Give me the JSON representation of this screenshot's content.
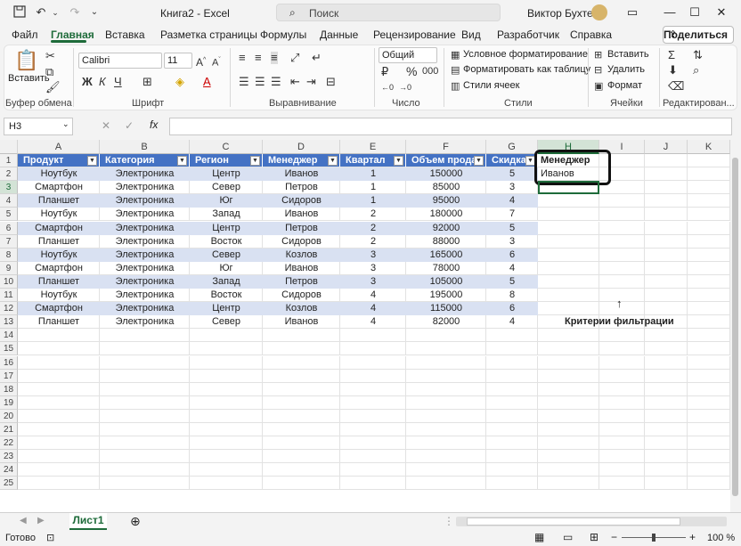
{
  "window": {
    "title": "Книга2  -  Excel",
    "search_placeholder": "Поиск",
    "user": "Виктор Бухтеев"
  },
  "tabs": [
    "Файл",
    "Главная",
    "Вставка",
    "Разметка страницы",
    "Формулы",
    "Данные",
    "Рецензирование",
    "Вид",
    "Разработчик",
    "Справка"
  ],
  "share_label": "Поделиться",
  "ribbon": {
    "clipboard": {
      "paste_label": "Вставить",
      "group": "Буфер обмена"
    },
    "font": {
      "name": "Calibri",
      "size": "11",
      "group": "Шрифт"
    },
    "alignment": {
      "group": "Выравнивание"
    },
    "number": {
      "format": "Общий",
      "group": "Число"
    },
    "styles": {
      "cond_format": "Условное форматирование",
      "format_table": "Форматировать как таблицу",
      "cell_styles": "Стили ячеек",
      "group": "Стили"
    },
    "cells": {
      "insert": "Вставить",
      "delete": "Удалить",
      "format": "Формат",
      "group": "Ячейки"
    },
    "editing": {
      "group": "Редактирован..."
    }
  },
  "formula_bar": {
    "name_box": "H3",
    "formula": ""
  },
  "columns": [
    "A",
    "B",
    "C",
    "D",
    "E",
    "F",
    "G",
    "H",
    "I",
    "J",
    "K"
  ],
  "rows": [
    "1",
    "2",
    "3",
    "4",
    "5",
    "6",
    "7",
    "8",
    "9",
    "10",
    "11",
    "12",
    "13",
    "14",
    "15",
    "16",
    "17",
    "18",
    "19",
    "20",
    "21",
    "22",
    "23",
    "24",
    "25"
  ],
  "table": {
    "headers": [
      "Продукт",
      "Категория",
      "Регион",
      "Менеджер",
      "Квартал",
      "Объем продаж",
      "Скидка"
    ],
    "rows": [
      [
        "Ноутбук",
        "Электроника",
        "Центр",
        "Иванов",
        "1",
        "150000",
        "5"
      ],
      [
        "Смартфон",
        "Электроника",
        "Север",
        "Петров",
        "1",
        "85000",
        "3"
      ],
      [
        "Планшет",
        "Электроника",
        "Юг",
        "Сидоров",
        "1",
        "95000",
        "4"
      ],
      [
        "Ноутбук",
        "Электроника",
        "Запад",
        "Иванов",
        "2",
        "180000",
        "7"
      ],
      [
        "Смартфон",
        "Электроника",
        "Центр",
        "Петров",
        "2",
        "92000",
        "5"
      ],
      [
        "Планшет",
        "Электроника",
        "Восток",
        "Сидоров",
        "2",
        "88000",
        "3"
      ],
      [
        "Ноутбук",
        "Электроника",
        "Север",
        "Козлов",
        "3",
        "165000",
        "6"
      ],
      [
        "Смартфон",
        "Электроника",
        "Юг",
        "Иванов",
        "3",
        "78000",
        "4"
      ],
      [
        "Планшет",
        "Электроника",
        "Запад",
        "Петров",
        "3",
        "105000",
        "5"
      ],
      [
        "Ноутбук",
        "Электроника",
        "Восток",
        "Сидоров",
        "4",
        "195000",
        "8"
      ],
      [
        "Смартфон",
        "Электроника",
        "Центр",
        "Козлов",
        "4",
        "115000",
        "6"
      ],
      [
        "Планшет",
        "Электроника",
        "Север",
        "Иванов",
        "4",
        "82000",
        "4"
      ]
    ]
  },
  "criteria": {
    "header": "Менеджер",
    "value": "Иванов",
    "label": "Критерии фильтрации"
  },
  "sheet_tab": "Лист1",
  "status": {
    "ready": "Готово",
    "zoom": "100 %"
  },
  "colors": {
    "accent": "#1e6b3a",
    "table_header": "#4472c4",
    "band": "#d9e1f2"
  }
}
